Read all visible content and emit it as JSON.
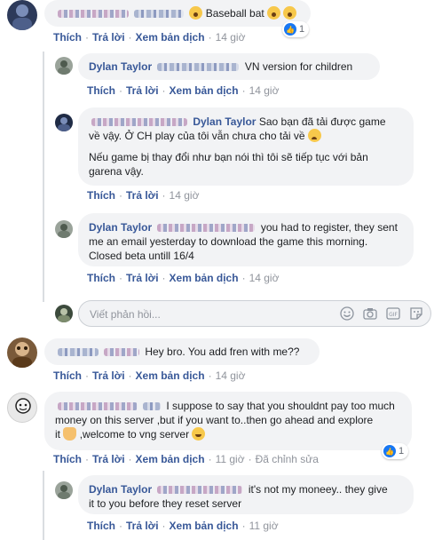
{
  "comments": [
    {
      "id": "c1",
      "text_after": "Baseball bat",
      "actions": {
        "like": "Thích",
        "reply": "Trả lời",
        "translate": "Xem bản dịch",
        "time": "14 giờ"
      },
      "reactions": {
        "count": "1"
      }
    },
    {
      "id": "r1",
      "author": "Dylan Taylor",
      "text": "VN version for children",
      "actions": {
        "like": "Thích",
        "reply": "Trả lời",
        "translate": "Xem bản dịch",
        "time": "14 giờ"
      }
    },
    {
      "id": "r2",
      "tag": "Dylan Taylor",
      "text_line1": "Sao bạn đã tải được game",
      "text_line2": "về vậy. Ở CH play của tôi vẫn chưa cho tải về",
      "text_para2": "Nếu game bị thay đổi như bạn nói thì tôi sẽ tiếp tục với bản garena vậy.",
      "actions": {
        "like": "Thích",
        "reply": "Trả lời",
        "time": "14 giờ"
      }
    },
    {
      "id": "r3",
      "author": "Dylan Taylor",
      "text": "you had to register, they sent me an email yesterday to download the game this morning. Closed beta untill 16/4",
      "actions": {
        "like": "Thích",
        "reply": "Trả lời",
        "translate": "Xem bản dịch",
        "time": "14 giờ"
      }
    },
    {
      "id": "c2",
      "text": "Hey bro. You add fren with me??",
      "actions": {
        "like": "Thích",
        "reply": "Trả lời",
        "translate": "Xem bản dịch",
        "time": "14 giờ"
      }
    },
    {
      "id": "c3",
      "text_line1": "I suppose to say that you shouldnt pay too much",
      "text_line2": "money on this server ,but if you want to..then go ahead and explore",
      "text_line3a": "it",
      "text_line3b": ",welcome to vng server",
      "actions": {
        "like": "Thích",
        "reply": "Trả lời",
        "translate": "Xem bản dịch",
        "time": "11 giờ",
        "edited": "Đã chỉnh sửa"
      },
      "reactions": {
        "count": "1"
      }
    },
    {
      "id": "r4",
      "author": "Dylan Taylor",
      "text_line1": "it's not my moneey.. they give",
      "text_line2": "it to you before they reset server",
      "actions": {
        "like": "Thích",
        "reply": "Trả lời",
        "translate": "Xem bản dịch",
        "time": "11 giờ"
      }
    }
  ],
  "reply_box": {
    "placeholder": "Viết phản hồi..."
  },
  "icons": [
    "emoji-icon",
    "camera-icon",
    "gif-icon",
    "sticker-icon",
    "like-icon",
    "wow-emoji",
    "sad-emoji",
    "hand-emoji",
    "grin-emoji"
  ],
  "colors": {
    "link": "#385898",
    "bubble": "#f2f3f5",
    "like_blue": "#1877f2",
    "meta_gray": "#90949c"
  }
}
